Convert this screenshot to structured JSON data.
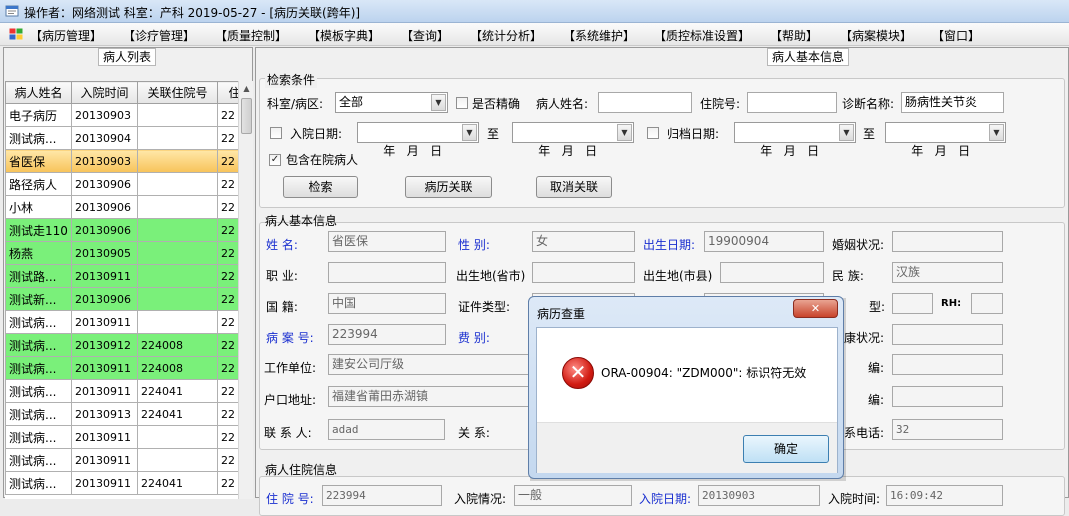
{
  "titlebar": {
    "title": "操作者：网络测试 科室：产科 2019-05-27 - [病历关联(跨年)]"
  },
  "menu": [
    "【病历管理】",
    "【诊疗管理】",
    "【质量控制】",
    "【模板字典】",
    "【查询】",
    "【统计分析】",
    "【系统维护】",
    "【质控标准设置】",
    "【帮助】",
    "【病案模块】",
    "【窗口】"
  ],
  "left_panel": {
    "caption": "病人列表",
    "columns": [
      "病人姓名",
      "入院时间",
      "关联住院号",
      "住"
    ],
    "rows": [
      {
        "name": "电子病历",
        "date": "20130903",
        "link": "",
        "extra": "22",
        "style": "white"
      },
      {
        "name": "测试病...",
        "date": "20130904",
        "link": "",
        "extra": "22",
        "style": "white"
      },
      {
        "name": "省医保",
        "date": "20130903",
        "link": "",
        "extra": "22",
        "style": "sel"
      },
      {
        "name": "路径病人",
        "date": "20130906",
        "link": "",
        "extra": "22",
        "style": "white"
      },
      {
        "name": "小林",
        "date": "20130906",
        "link": "",
        "extra": "22",
        "style": "white"
      },
      {
        "name": "测试走110",
        "date": "20130906",
        "link": "",
        "extra": "22",
        "style": "green"
      },
      {
        "name": "杨燕",
        "date": "20130905",
        "link": "",
        "extra": "22",
        "style": "green"
      },
      {
        "name": "测试路...",
        "date": "20130911",
        "link": "",
        "extra": "22",
        "style": "green"
      },
      {
        "name": "测试新...",
        "date": "20130906",
        "link": "",
        "extra": "22",
        "style": "green"
      },
      {
        "name": "测试病...",
        "date": "20130911",
        "link": "",
        "extra": "22",
        "style": "white"
      },
      {
        "name": "测试病...",
        "date": "20130912",
        "link": "224008",
        "extra": "22",
        "style": "green"
      },
      {
        "name": "测试病...",
        "date": "20130911",
        "link": "224008",
        "extra": "22",
        "style": "green"
      },
      {
        "name": "测试病...",
        "date": "20130911",
        "link": "224041",
        "extra": "22",
        "style": "white"
      },
      {
        "name": "测试病...",
        "date": "20130913",
        "link": "224041",
        "extra": "22",
        "style": "white"
      },
      {
        "name": "测试病...",
        "date": "20130911",
        "link": "",
        "extra": "22",
        "style": "white"
      },
      {
        "name": "测试病...",
        "date": "20130911",
        "link": "",
        "extra": "22",
        "style": "white"
      },
      {
        "name": "测试病...",
        "date": "20130911",
        "link": "224041",
        "extra": "22",
        "style": "white"
      }
    ]
  },
  "right_panel": {
    "caption": "病人基本信息",
    "search": {
      "group_title": "检索条件",
      "dept_label": "科室/病区:",
      "dept_value": "全部",
      "exact_label": "是否精确",
      "name_label": "病人姓名:",
      "inpatient_no_label": "住院号:",
      "diagnosis_label": "诊断名称:",
      "diagnosis_value": "肠病性关节炎",
      "admit_date_label": "入院日期:",
      "archive_date_label": "归档日期:",
      "to_label": "至",
      "date_placeholder": "年   月   日",
      "include_label": "包含在院病人",
      "include_checked": "✓",
      "btn_search": "检索",
      "btn_link": "病历关联",
      "btn_unlink": "取消关联"
    },
    "basic": {
      "group_title": "病人基本信息",
      "name_label": "姓    名:",
      "name_value": "省医保",
      "sex_label": "性    别:",
      "sex_value": "女",
      "birth_label": "出生日期:",
      "birth_value": "19900904",
      "marital_label": "婚姻状况:",
      "job_label": "职    业:",
      "birthplace_prov_label": "出生地(省市)",
      "birthplace_city_label": "出生地(市县)",
      "ethnic_label": "民    族:",
      "ethnic_value": "汉族",
      "nation_label": "国    籍:",
      "nation_value": "中国",
      "idtype_label": "证件类型:",
      "blood_label": "型:",
      "rh_label": "RH:",
      "case_no_label": "病 案 号:",
      "case_no_value": "223994",
      "fee_label": "费    别:",
      "health_label": "康状况:",
      "work_label": "工作单位:",
      "work_value": "建安公司厅级",
      "code1_label": "编:",
      "addr_label": "户口地址:",
      "addr_value": "福建省莆田赤湖镇",
      "code2_label": "编:",
      "contact_label": "联 系 人:",
      "contact_value": "adad",
      "relation_label": "关    系:",
      "phone_label": "系电话:",
      "phone_value": "32"
    },
    "admission": {
      "group_title": "病人住院信息",
      "no_label": "住 院 号:",
      "no_value": "223994",
      "cond_label": "入院情况:",
      "cond_value": "一般",
      "date_label": "入院日期:",
      "date_value": "20130903",
      "time_label": "入院时间:",
      "time_value": "16:09:42"
    }
  },
  "dialog": {
    "title": "病历查重",
    "close": "✕",
    "icon": "error-icon",
    "icon_glyph": "✕",
    "message": "ORA-00904: \"ZDM000\": 标识符无效",
    "ok": "确定"
  },
  "colors": {
    "label_blue": "#1a2fd0",
    "row_green": "#7af07a",
    "row_selected": "#f7c35a",
    "error_red": "#d11b12"
  }
}
